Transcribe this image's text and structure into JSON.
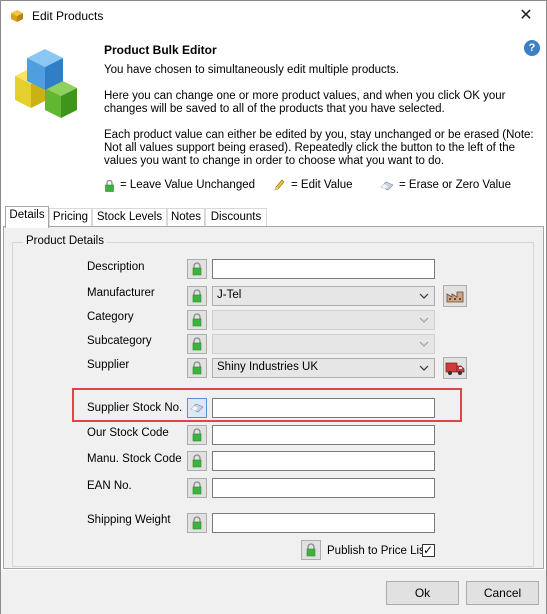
{
  "window": {
    "title": "Edit Products",
    "close_glyph": "✕"
  },
  "header": {
    "title": "Product Bulk Editor",
    "line1": "You have chosen to simultaneously edit multiple products.",
    "para2_a": "Here you can change one or more product values, and when you click OK your",
    "para2_b": "changes will be saved to all of the products that you have selected.",
    "para3_a": "Each product value can either be edited by you, stay unchanged or be erased (Note:",
    "para3_b": "Not all values support being erased). Repeatedly click the button to the left of the",
    "para3_c": "values you want to change in order to choose what you want to do.",
    "help_glyph": "?"
  },
  "legend": {
    "unchanged": "= Leave Value Unchanged",
    "edit": "= Edit Value",
    "erase": "= Erase or Zero Value"
  },
  "tabs": [
    "Details",
    "Pricing",
    "Stock Levels",
    "Notes",
    "Discounts"
  ],
  "details": {
    "group_title": "Product Details",
    "description": {
      "label": "Description",
      "value": ""
    },
    "manufacturer": {
      "label": "Manufacturer",
      "value": "J-Tel"
    },
    "category": {
      "label": "Category",
      "value": ""
    },
    "subcategory": {
      "label": "Subcategory",
      "value": ""
    },
    "supplier": {
      "label": "Supplier",
      "value": "Shiny Industries UK"
    },
    "supplier_stock_no": {
      "label": "Supplier Stock No.",
      "value": ""
    },
    "our_stock_code": {
      "label": "Our Stock Code",
      "value": ""
    },
    "manu_stock_code": {
      "label": "Manu. Stock Code",
      "value": ""
    },
    "ean_no": {
      "label": "EAN No.",
      "value": ""
    },
    "shipping_weight": {
      "label": "Shipping Weight",
      "value": ""
    },
    "publish": {
      "label": "Publish to Price List",
      "checked": true,
      "check_glyph": "✓"
    }
  },
  "footer": {
    "ok": "Ok",
    "cancel": "Cancel"
  },
  "colors": {
    "highlight": "#e0434a",
    "lock_green": "#3fb13f",
    "help_blue": "#3c7fc4"
  }
}
